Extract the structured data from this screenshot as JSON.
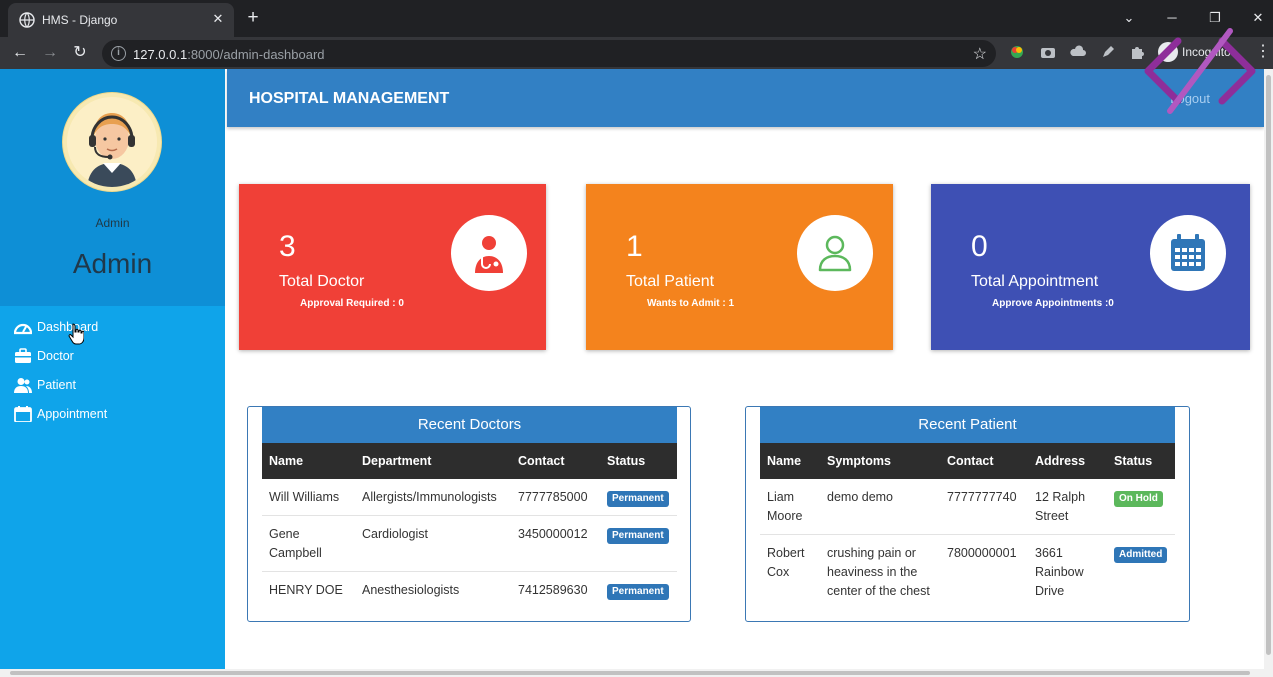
{
  "browser": {
    "tab_title": "HMS - Django",
    "tab_close": "✕",
    "new_tab": "+",
    "url_host": "127.0.0.1",
    "url_rest": ":8000/admin-dashboard",
    "incognito_label": "Incognito"
  },
  "header": {
    "brand": "HOSPITAL MANAGEMENT",
    "logout": "Logout"
  },
  "sidebar": {
    "role": "Admin",
    "username": "Admin",
    "items": [
      {
        "label": "Dashboard",
        "icon": "dashboard-icon"
      },
      {
        "label": "Doctor",
        "icon": "briefcase-icon"
      },
      {
        "label": "Patient",
        "icon": "users-icon"
      },
      {
        "label": "Appointment",
        "icon": "calendar-icon"
      }
    ]
  },
  "cards": [
    {
      "count": "3",
      "label": "Total Doctor",
      "sub": "Approval Required : 0",
      "color": "#f04037",
      "icon": "doctor-icon"
    },
    {
      "count": "1",
      "label": "Total Patient",
      "sub": "Wants to Admit : 1",
      "color": "#f4831d",
      "icon": "user-icon"
    },
    {
      "count": "0",
      "label": "Total Appointment",
      "sub": "Approve Appointments :0",
      "color": "#3e50b4",
      "icon": "calendar-icon"
    }
  ],
  "recent_doctors": {
    "title": "Recent Doctors",
    "columns": [
      "Name",
      "Department",
      "Contact",
      "Status"
    ],
    "rows": [
      {
        "name": "Will Williams",
        "department": "Allergists/Immunologists",
        "contact": "7777785000",
        "status": "Permanent"
      },
      {
        "name": "Gene Campbell",
        "department": "Cardiologist",
        "contact": "3450000012",
        "status": "Permanent"
      },
      {
        "name": "HENRY DOE",
        "department": "Anesthesiologists",
        "contact": "7412589630",
        "status": "Permanent"
      }
    ]
  },
  "recent_patients": {
    "title": "Recent Patient",
    "columns": [
      "Name",
      "Symptoms",
      "Contact",
      "Address",
      "Status"
    ],
    "rows": [
      {
        "name": "Liam Moore",
        "symptoms": "demo demo",
        "contact": "7777777740",
        "address": "12 Ralph Street",
        "status": "On Hold"
      },
      {
        "name": "Robert Cox",
        "symptoms": "crushing pain or heaviness in the center of the chest",
        "contact": "7800000001",
        "address": "3661 Rainbow Drive",
        "status": "Admitted"
      }
    ]
  },
  "colors": {
    "sidebar": "#0fa4ea",
    "header": "#3280c4",
    "table_head": "#2d2d2d"
  }
}
